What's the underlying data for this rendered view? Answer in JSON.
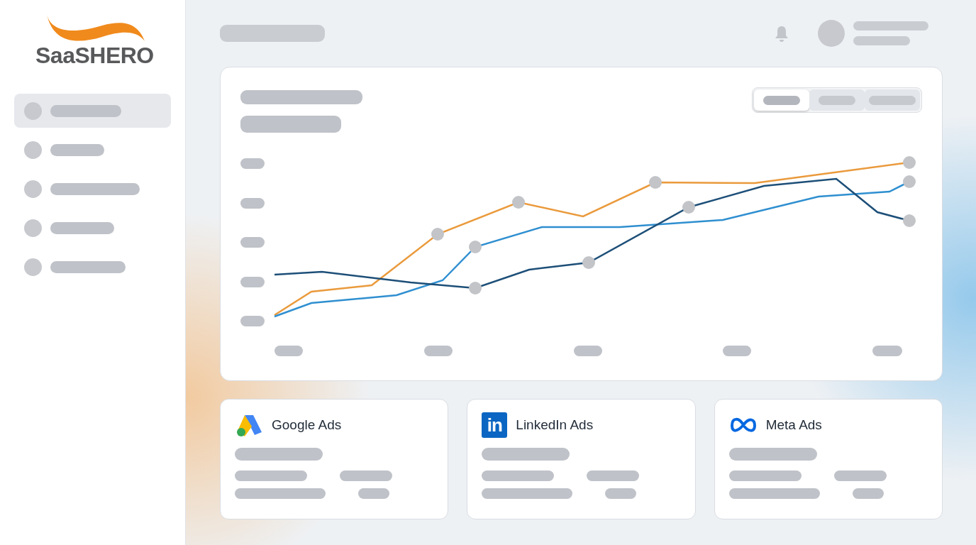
{
  "sidebar": {
    "logo": "SaaSHERO",
    "items": [
      {
        "selected": true
      },
      {
        "selected": false
      },
      {
        "selected": false
      },
      {
        "selected": false
      },
      {
        "selected": false
      }
    ]
  },
  "chart_card": {
    "range_tabs": [
      {
        "selected": true
      },
      {
        "selected": false
      },
      {
        "selected": false
      }
    ]
  },
  "cards": [
    {
      "kind": "google",
      "title": "Google Ads"
    },
    {
      "kind": "linkedin",
      "title": "LinkedIn Ads",
      "badge": "in"
    },
    {
      "kind": "meta",
      "title": "Meta Ads"
    }
  ]
}
